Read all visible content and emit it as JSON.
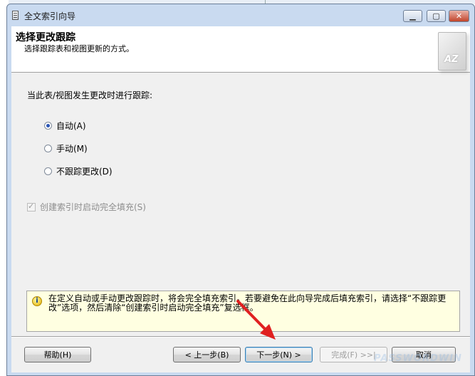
{
  "window": {
    "title": "全文索引向导"
  },
  "header": {
    "title": "选择更改跟踪",
    "subtitle": "选择跟踪表和视图更新的方式。"
  },
  "main": {
    "prompt": "当此表/视图发生更改时进行跟踪:",
    "options": [
      {
        "label": "自动(A)",
        "selected": true
      },
      {
        "label": "手动(M)",
        "selected": false
      },
      {
        "label": "不跟踪更改(D)",
        "selected": false
      }
    ],
    "checkbox": {
      "label": "创建索引时启动完全填充(S)",
      "checked": true,
      "enabled": false
    },
    "info": "在定义自动或手动更改跟踪时，将会完全填充索引。若要避免在此向导完成后填充索引，请选择“不跟踪更改”选项，然后清除“创建索引时启动完全填充”复选框。"
  },
  "buttons": {
    "help": "帮助(H)",
    "back": "< 上一步(B)",
    "next": "下一步(N) >",
    "finish": "完成(F) >>|",
    "cancel": "取消"
  },
  "watermark": "PASSWORDWIN",
  "colors": {
    "titlebar": "#c9daf0",
    "info_background": "#ffffe1",
    "arrow": "#e02020"
  }
}
